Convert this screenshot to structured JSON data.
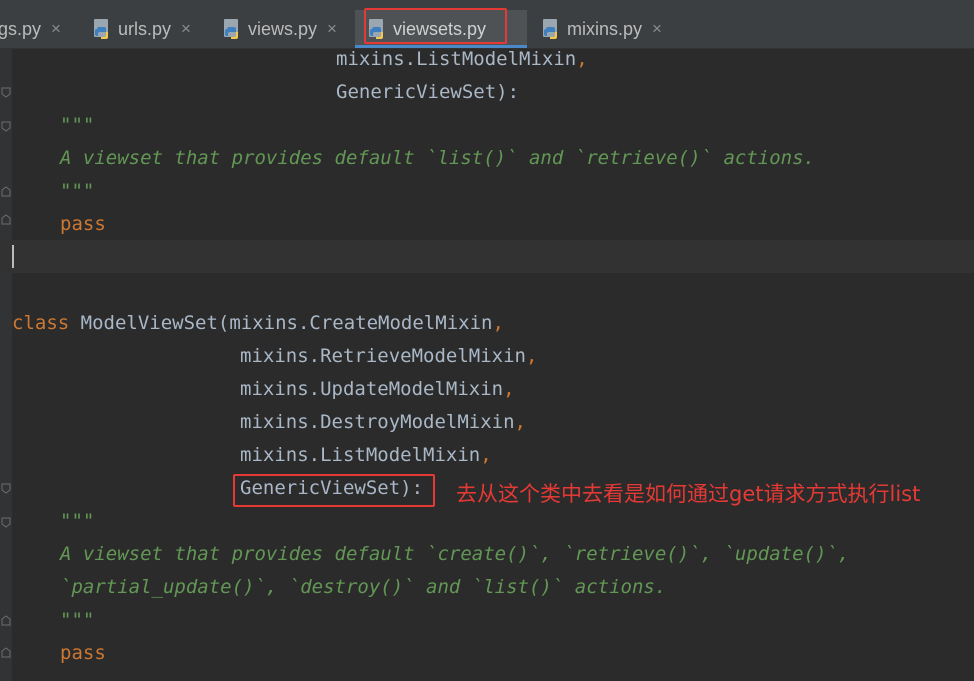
{
  "tabs": [
    {
      "label": "gs.py",
      "close": "×"
    },
    {
      "label": "urls.py",
      "close": "×"
    },
    {
      "label": "views.py",
      "close": "×"
    },
    {
      "label": "viewsets.py",
      "close": ""
    },
    {
      "label": "mixins.py",
      "close": "×"
    }
  ],
  "code": {
    "l1": "mixins.ListModelMixin",
    "l2": "GenericViewSet):",
    "q1": "\"\"\"",
    "d1": "A viewset that provides default `list()` and `retrieve()` actions.",
    "q2": "\"\"\"",
    "p1": "pass",
    "kw_class": "class",
    "cls_decl": " ModelViewSet(mixins.CreateModelMixin",
    "m1": "mixins.RetrieveModelMixin",
    "m2": "mixins.UpdateModelMixin",
    "m3": "mixins.DestroyModelMixin",
    "m4": "mixins.ListModelMixin",
    "m5": "GenericViewSet):",
    "q3": "\"\"\"",
    "d2": "A viewset that provides default `create()`, `retrieve()`, `update()`,",
    "d3": "`partial_update()`, `destroy()` and `list()` actions.",
    "q4": "\"\"\"",
    "p2": "pass",
    "comma": ","
  },
  "annotation": "去从这个类中去看是如何通过get请求方式执行list",
  "colors": {
    "keyword": "#cc7832",
    "docstring": "#629755",
    "text": "#a9b7c6",
    "highlight_box": "#e53935",
    "tab_accent": "#4a88c7"
  },
  "icons": {
    "tab_file": "python-file-icon",
    "fold": "fold-marker-icon"
  }
}
